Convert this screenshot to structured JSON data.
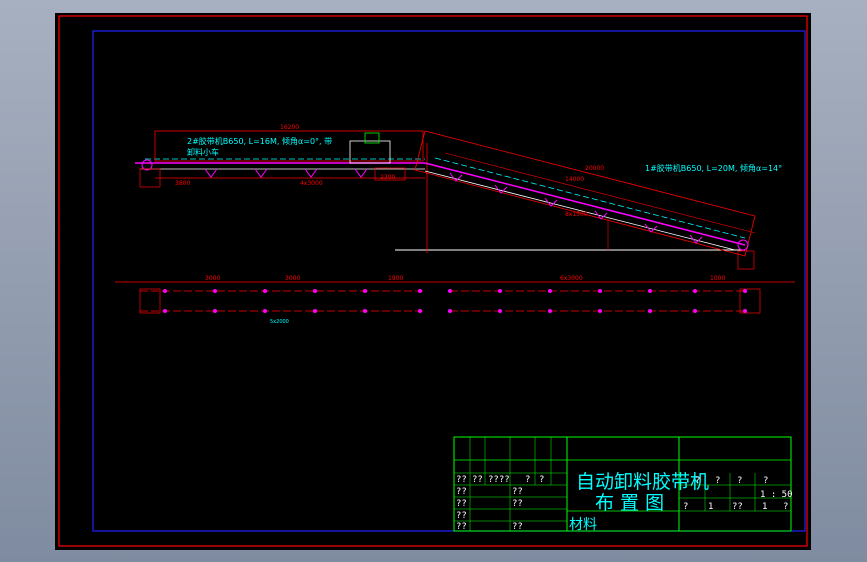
{
  "drawing": {
    "title_line1": "自动卸料胶带机",
    "title_line2": "布 置 图",
    "material_label": "材料",
    "scale": "1 : 50"
  },
  "annotations": {
    "conveyor_2": "2#胶带机B650, L=16M, 倾角α=0°, 带",
    "conveyor_2_sub": "卸料小车",
    "conveyor_1": "1#胶带机B650, L=20M, 倾角α=14°"
  },
  "dimensions": {
    "d1": "16200",
    "d2": "3800",
    "d3": "4x3000",
    "d4": "2300",
    "d5": "20000",
    "d6": "14000",
    "d7": "8x1500",
    "d8": "3000",
    "d9": "3000",
    "d10": "1900",
    "d11": "6x3000",
    "d12": "5x2000",
    "d13": "1000"
  },
  "title_block": {
    "row_a": [
      "??",
      "??",
      "????",
      "?",
      "?"
    ],
    "row_b": [
      "??",
      "??"
    ],
    "row_c": [
      "??",
      "??"
    ],
    "row_d": [
      "??"
    ],
    "row_e": [
      "??",
      "??"
    ],
    "right_top": [
      "?",
      "?",
      "?",
      "?"
    ],
    "right_bottom": [
      "?",
      "1",
      "??",
      "1",
      "?"
    ]
  }
}
